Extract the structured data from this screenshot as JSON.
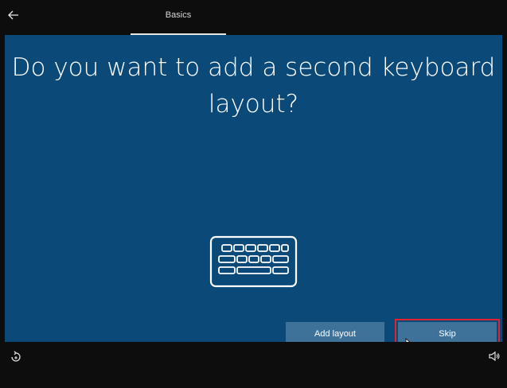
{
  "topbar": {
    "back_icon": "arrow-left-icon",
    "tab_label": "Basics"
  },
  "main": {
    "heading": "Do you want to add a second keyboard layout?",
    "illustration_icon": "keyboard-icon",
    "background_color": "#0b4a78"
  },
  "actions": {
    "add_layout_label": "Add layout",
    "skip_label": "Skip",
    "highlight_color": "#e2232f"
  },
  "bottombar": {
    "left_icon": "ease-of-access-icon",
    "right_icon": "volume-icon"
  }
}
